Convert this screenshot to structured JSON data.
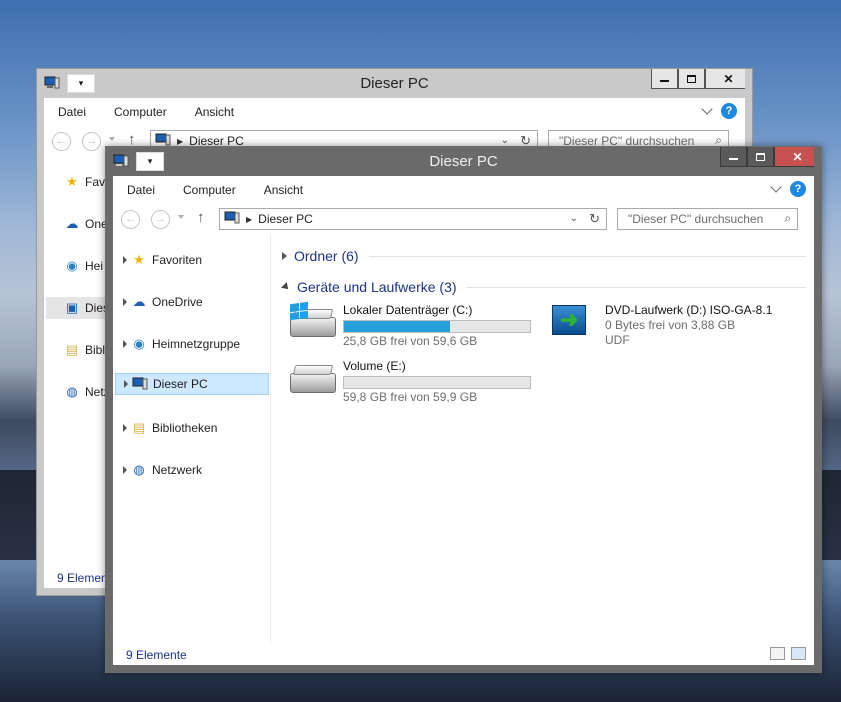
{
  "colors": {
    "accent": "#26a0da",
    "group_heading": "#1e3287",
    "close_red": "#c75050",
    "selection": "#cde8ff"
  },
  "back_window": {
    "title": "Dieser PC",
    "ribbon_tabs": [
      "Datei",
      "Computer",
      "Ansicht"
    ],
    "address": "Dieser PC",
    "search_placeholder": "\"Dieser PC\" durchsuchen",
    "nav_items": [
      "Fav",
      "One",
      "Hei",
      "Dies",
      "Bibl",
      "Netz"
    ],
    "status": "9 Elemen"
  },
  "front_window": {
    "title": "Dieser PC",
    "ribbon_tabs": [
      "Datei",
      "Computer",
      "Ansicht"
    ],
    "address": "Dieser PC",
    "search_placeholder": "\"Dieser PC\" durchsuchen",
    "help_label": "?",
    "nav_items": [
      {
        "label": "Favoriten",
        "icon": "star-icon"
      },
      {
        "label": "OneDrive",
        "icon": "onedrive-icon"
      },
      {
        "label": "Heimnetzgruppe",
        "icon": "homegroup-icon"
      },
      {
        "label": "Dieser PC",
        "icon": "computer-icon",
        "selected": true
      },
      {
        "label": "Bibliotheken",
        "icon": "libraries-icon"
      },
      {
        "label": "Netzwerk",
        "icon": "network-icon"
      }
    ],
    "groups": {
      "folders": "Ordner (6)",
      "drives": "Geräte und Laufwerke (3)"
    },
    "drives": [
      {
        "name": "Lokaler Datenträger (C:)",
        "free": "25,8 GB frei von 59,6 GB",
        "used_fraction": 0.57,
        "icon": "system-drive-icon"
      },
      {
        "name": "DVD-Laufwerk (D:) ISO-GA-8.1",
        "free": "0 Bytes frei von 3,88 GB",
        "fs": "UDF",
        "icon": "dvd-drive-icon"
      },
      {
        "name": "Volume (E:)",
        "free": "59,8 GB frei von 59,9 GB",
        "used_fraction": 0.0,
        "icon": "hard-drive-icon"
      }
    ],
    "status": "9 Elemente"
  }
}
